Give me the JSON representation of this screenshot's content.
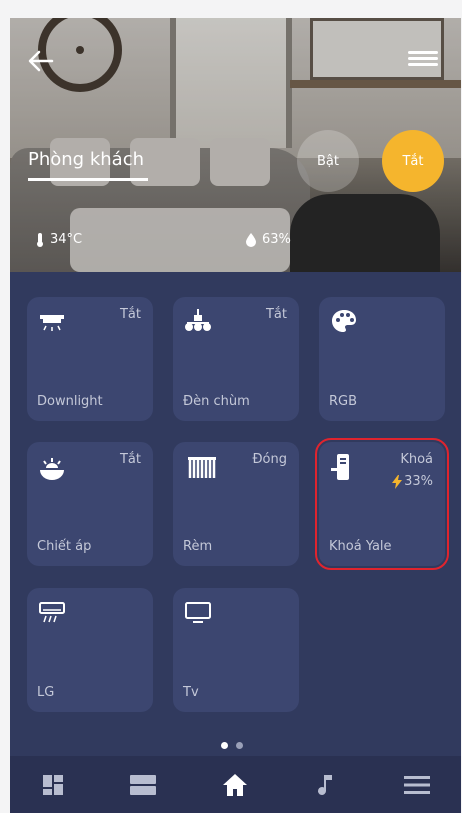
{
  "header": {
    "room_title": "Phòng khách",
    "on_label": "Bật",
    "off_label": "Tắt",
    "temperature": "34°C",
    "humidity": "63%"
  },
  "devices": [
    {
      "name": "Downlight",
      "status": "Tắt",
      "icon": "downlight-icon"
    },
    {
      "name": "Đèn chùm",
      "status": "Tắt",
      "icon": "chandelier-icon"
    },
    {
      "name": "RGB",
      "status": "",
      "icon": "palette-icon"
    },
    {
      "name": "Chiết áp",
      "status": "Tắt",
      "icon": "dimmer-icon"
    },
    {
      "name": "Rèm",
      "status": "Đóng",
      "icon": "curtain-icon"
    },
    {
      "name": "Khoá Yale",
      "status": "Khoá",
      "battery": "33%",
      "icon": "door-lock-icon"
    },
    {
      "name": "LG",
      "status": "",
      "icon": "air-conditioner-icon"
    },
    {
      "name": "Tv",
      "status": "",
      "icon": "tv-icon"
    }
  ],
  "pagination": {
    "current": 1,
    "total": 2
  },
  "colors": {
    "background": "#313a5e",
    "tile": "#3c4670",
    "accent": "#f5b52d",
    "highlight": "#e0242e"
  },
  "nav": [
    "dashboard-icon",
    "scenes-icon",
    "home-icon",
    "music-icon",
    "menu-icon"
  ]
}
